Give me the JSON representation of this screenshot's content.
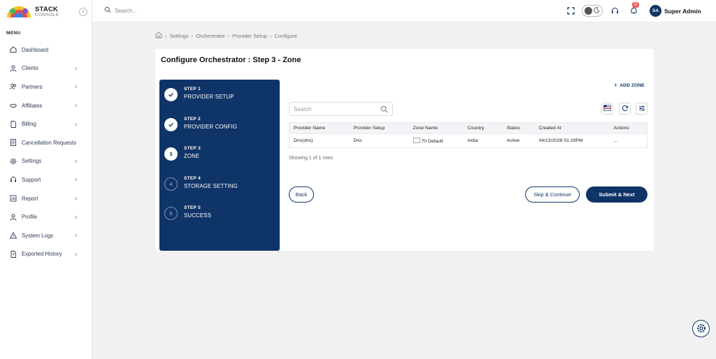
{
  "brand": {
    "name": "STACK",
    "sub": "CONSOLE"
  },
  "sidebar": {
    "menu_title": "MENU",
    "items": [
      {
        "label": "Dashboard",
        "icon": "home-icon",
        "has_children": false
      },
      {
        "label": "Clients",
        "icon": "user-icon",
        "has_children": true
      },
      {
        "label": "Partners",
        "icon": "users-icon",
        "has_children": true
      },
      {
        "label": "Affiliates",
        "icon": "handshake-icon",
        "has_children": true
      },
      {
        "label": "Billing",
        "icon": "file-icon",
        "has_children": true
      },
      {
        "label": "Cancellation Requests",
        "icon": "document-icon",
        "has_children": false
      },
      {
        "label": "Settings",
        "icon": "gear-icon",
        "has_children": true
      },
      {
        "label": "Support",
        "icon": "support-icon",
        "has_children": true
      },
      {
        "label": "Report",
        "icon": "report-icon",
        "has_children": true
      },
      {
        "label": "Profile",
        "icon": "profile-icon",
        "has_children": true
      },
      {
        "label": "System Logs",
        "icon": "warning-icon",
        "has_children": true
      },
      {
        "label": "Exported History",
        "icon": "export-icon",
        "has_children": true
      }
    ]
  },
  "topbar": {
    "search_placeholder": "Search...",
    "notification_count": "15",
    "user": {
      "initials": "SA",
      "name": "Super Admin"
    }
  },
  "breadcrumb": [
    "Settings",
    "Orchestrator",
    "Provider Setup",
    "Configure"
  ],
  "page": {
    "title": "Configure Orchestrator : Step 3 - Zone",
    "add_zone_label": "ADD ZONE",
    "table_search_placeholder": "Search"
  },
  "steps": [
    {
      "number": "STEP 1",
      "name": "PROVIDER SETUP",
      "status": "done",
      "marker": ""
    },
    {
      "number": "STEP 2",
      "name": "PROVIDER CONFIG",
      "status": "done",
      "marker": ""
    },
    {
      "number": "STEP 3",
      "name": "ZONE",
      "status": "active",
      "marker": "3"
    },
    {
      "number": "STEP 4",
      "name": "STORAGE SETTING",
      "status": "pending",
      "marker": "4"
    },
    {
      "number": "STEP 5",
      "name": "SUCCESS",
      "status": "pending",
      "marker": "5"
    }
  ],
  "table": {
    "columns": [
      "Provider Name",
      "Provider Setup",
      "Zone Name",
      "Country",
      "Status",
      "Created At",
      "Actions"
    ],
    "rows": [
      {
        "provider_name": "Dns(dns)",
        "provider_setup": "Dns",
        "zone_img_alt": "70",
        "zone_name": "Default",
        "country": "India",
        "status": "Active",
        "created_at": "04/13/2026 01:29PM",
        "actions": "..."
      }
    ],
    "footer": "Showing 1 of 1 rows"
  },
  "buttons": {
    "back": "Back",
    "skip": "Skip & Continue",
    "submit": "Submit & Next"
  },
  "colors": {
    "primary": "#0f3468",
    "badge": "#f05b5b"
  }
}
